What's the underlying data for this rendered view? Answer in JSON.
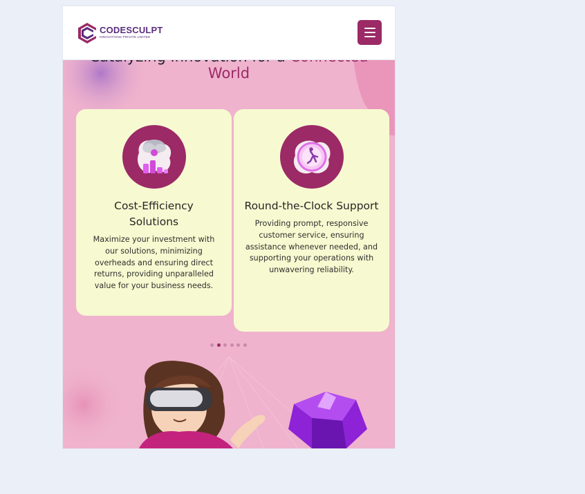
{
  "header": {
    "logo_name": "CODESCULPT",
    "logo_tagline": "INNOVATIONS PRIVATE LIMITED",
    "menu_icon": "hamburger-menu-icon"
  },
  "hero": {
    "title_prefix": "Catalyzing Innovation for a ",
    "title_accent": "Connected",
    "title_line2": "World"
  },
  "cards": [
    {
      "icon": "cost-efficiency-icon",
      "title": "Cost-Efficiency Solutions",
      "text": "Maximize your investment with our solutions, minimizing overheads and ensuring direct returns, providing unparalleled value for your business needs."
    },
    {
      "icon": "round-the-clock-support-icon",
      "title": "Round-the-Clock Support",
      "text": "Providing prompt, responsive customer service, ensuring assistance whenever needed, and supporting your operations with unwavering reliability."
    }
  ],
  "carousel": {
    "slide_count": 6,
    "active_index": 1
  },
  "colors": {
    "brand": "#9b2a66",
    "card_bg": "#f7fad0",
    "hero_bg": "#efb3cd",
    "page_bg": "#ebeff8"
  }
}
